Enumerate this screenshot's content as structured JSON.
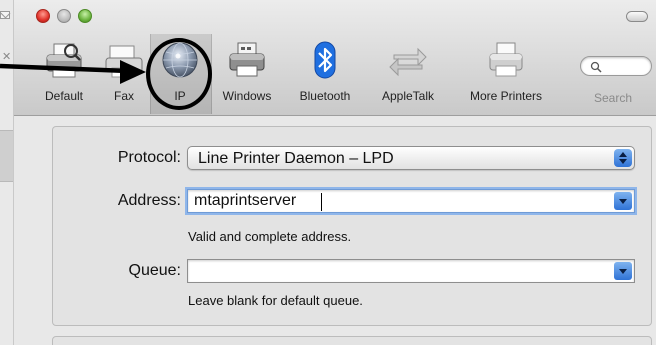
{
  "window": {
    "controls": [
      "close",
      "minimize",
      "zoom"
    ]
  },
  "toolbar": {
    "selected": "IP",
    "items": [
      {
        "label": "Default",
        "icon": "printer-icon"
      },
      {
        "label": "Fax",
        "icon": "fax-icon"
      },
      {
        "label": "IP",
        "icon": "globe-icon"
      },
      {
        "label": "Windows",
        "icon": "printer-icon"
      },
      {
        "label": "Bluetooth",
        "icon": "bluetooth-icon"
      },
      {
        "label": "AppleTalk",
        "icon": "appletalk-icon"
      },
      {
        "label": "More Printers",
        "icon": "printer-icon"
      }
    ],
    "search_label": "Search"
  },
  "form": {
    "protocol": {
      "label": "Protocol:",
      "value": "Line Printer Daemon – LPD"
    },
    "address": {
      "label": "Address:",
      "value": "mtaprintserver",
      "hint": "Valid and complete address."
    },
    "queue": {
      "label": "Queue:",
      "value": "",
      "hint": "Leave blank for default queue."
    }
  },
  "colors": {
    "accent_blue": "#2f72d6",
    "bluetooth_blue": "#1f6fe0",
    "annotation": "#000000"
  }
}
